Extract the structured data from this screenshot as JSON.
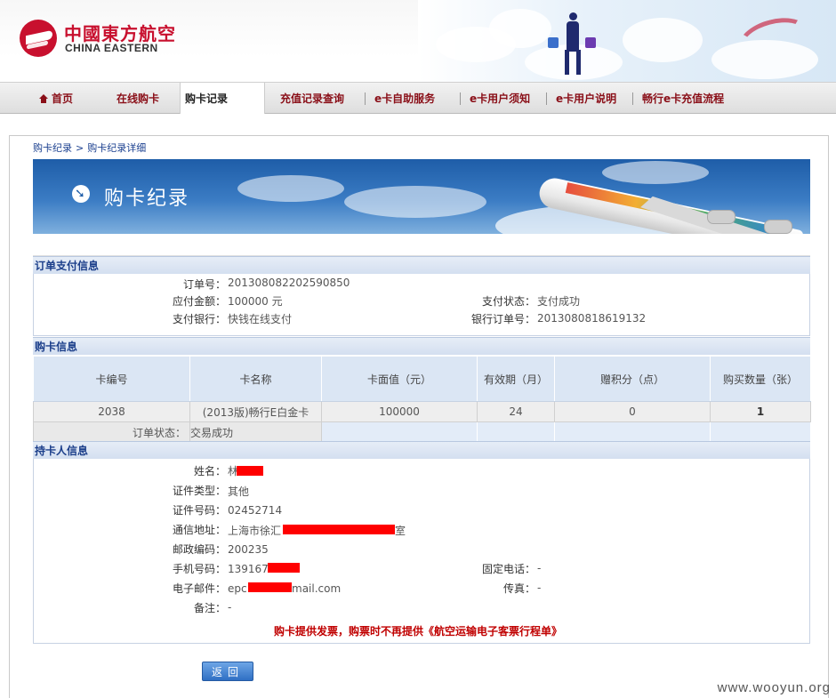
{
  "brand": {
    "name_cn": "中國東方航空",
    "name_en": "CHINA EASTERN"
  },
  "nav": {
    "items": [
      {
        "label": "首页"
      },
      {
        "label": "在线购卡"
      },
      {
        "label": "购卡记录"
      },
      {
        "label": "充值记录查询"
      },
      {
        "label": "e卡自助服务"
      },
      {
        "label": "e卡用户须知"
      },
      {
        "label": "e卡用户说明"
      },
      {
        "label": "畅行e卡充值流程"
      }
    ],
    "active": "购卡记录"
  },
  "breadcrumb": {
    "item1": "购卡纪录",
    "sep": ">",
    "item2": "购卡纪录详细"
  },
  "banner": {
    "title": "购卡纪录"
  },
  "order": {
    "section_title": "订单支付信息",
    "order_no_label": "订单号：",
    "order_no": "201308082202590850",
    "amount_label": "应付金额：",
    "amount": "100000 元",
    "bank_label": "支付银行：",
    "bank": "快钱在线支付",
    "pay_status_label": "支付状态：",
    "pay_status": "支付成功",
    "bank_order_label": "银行订单号：",
    "bank_order": "2013080818619132"
  },
  "cards": {
    "section_title": "购卡信息",
    "columns": [
      "卡编号",
      "卡名称",
      "卡面值（元）",
      "有效期（月）",
      "赠积分（点）",
      "购买数量（张）"
    ],
    "rows": [
      {
        "card_no": "2038",
        "card_name": "(2013版)畅行E白金卡",
        "face_value": "100000",
        "validity": "24",
        "points": "0",
        "quantity": "1"
      }
    ],
    "status_label": "订单状态：",
    "status": "交易成功"
  },
  "holder": {
    "section_title": "持卡人信息",
    "name_label": "姓名：",
    "name": "林",
    "id_type_label": "证件类型：",
    "id_type": "其他",
    "id_no_label": "证件号码：",
    "id_no": "02452714",
    "address_label": "通信地址：",
    "address_prefix": "上海市徐汇",
    "address_suffix": "室",
    "postcode_label": "邮政编码：",
    "postcode": "200235",
    "mobile_label": "手机号码：",
    "mobile": "1391676",
    "email_label": "电子邮件：",
    "email_prefix": "epc",
    "email_suffix": "mail.com",
    "remark_label": "备注：",
    "remark": "-",
    "phone_label": "固定电话：",
    "phone": "-",
    "fax_label": "传真：",
    "fax": "-"
  },
  "notice": "购卡提供发票，购票时不再提供《航空运输电子客票行程单》",
  "buttons": {
    "back": "返回"
  },
  "watermark": "www.wooyun.org",
  "colors": {
    "brand_red": "#c8102e",
    "nav_text": "#8a0f18",
    "section_text": "#1b3e8a",
    "notice_red": "#c00000",
    "redaction": "#ff0000"
  }
}
